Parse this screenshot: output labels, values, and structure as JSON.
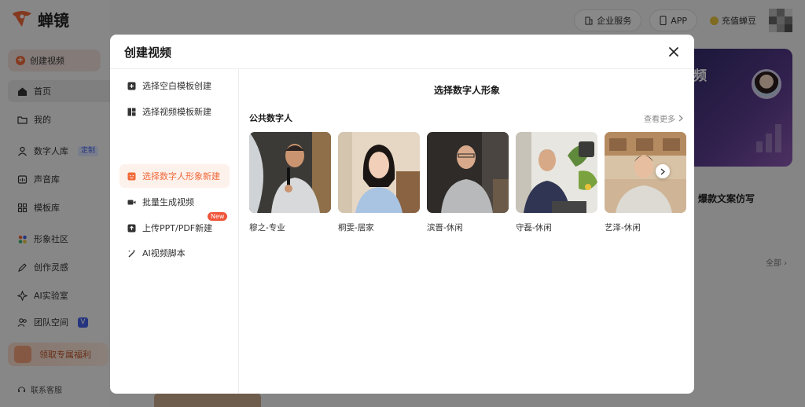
{
  "app": {
    "brand": "蝉镜",
    "create_label": "创建视频",
    "nav": [
      {
        "label": "首页",
        "icon": "home-icon"
      },
      {
        "label": "我的",
        "icon": "folder-icon"
      },
      {
        "label": "数字人库",
        "icon": "person-icon",
        "badge": "定制"
      },
      {
        "label": "声音库",
        "icon": "voice-icon"
      },
      {
        "label": "模板库",
        "icon": "grid-icon"
      },
      {
        "label": "形象社区",
        "icon": "community-icon"
      },
      {
        "label": "创作灵感",
        "icon": "pen-icon"
      },
      {
        "label": "AI实验室",
        "icon": "lab-icon"
      },
      {
        "label": "团队空间",
        "icon": "team-icon",
        "badge": "V"
      }
    ],
    "promo_label": "领取专属福利",
    "support_label": "联系客服",
    "header": {
      "enterprise_label": "企业服务",
      "app_label": "APP",
      "recharge_label": "充值蝉豆"
    },
    "banner_text": "频",
    "banner_title": "爆款文案仿写",
    "all_label": "全部"
  },
  "modal": {
    "title": "创建视频",
    "menu": [
      {
        "label": "选择空白模板创建",
        "icon": "plus-square-icon"
      },
      {
        "label": "选择视频模板新建",
        "icon": "template-icon"
      },
      {
        "label": "选择数字人形象新建",
        "icon": "avatar-face-icon",
        "active": true
      },
      {
        "label": "批量生成视频",
        "icon": "video-camera-icon"
      },
      {
        "label": "上传PPT/PDF新建",
        "icon": "upload-icon",
        "badge": "New"
      },
      {
        "label": "AI视频脚本",
        "icon": "magic-wand-icon"
      }
    ],
    "section_title": "选择数字人形象",
    "group_title": "公共数字人",
    "see_more_label": "查看更多",
    "avatars": [
      {
        "name": "穆之-专业"
      },
      {
        "name": "桐雯-居家"
      },
      {
        "name": "滨晋-休闲"
      },
      {
        "name": "守磊-休闲"
      },
      {
        "name": "艺泽-休闲"
      }
    ]
  },
  "colors": {
    "accent": "#f06a3a",
    "active_bg": "#fdf1ec",
    "badge_new": "#f0553a",
    "badge_blue": "#4662e8"
  }
}
